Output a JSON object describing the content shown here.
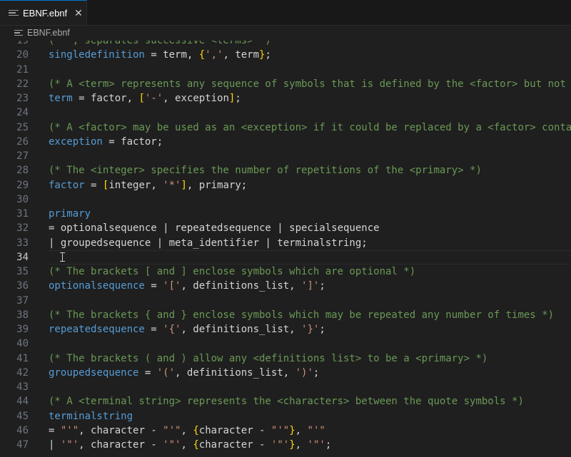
{
  "tab": {
    "label": "EBNF.ebnf",
    "close": "✕"
  },
  "breadcrumb": {
    "file": "EBNF.ebnf"
  },
  "lines": [
    {
      "n": "19",
      "t": [
        [
          "c",
          "(* ', separates successive <terms> *)"
        ]
      ]
    },
    {
      "n": "20",
      "t": [
        [
          "i",
          "singledefinition"
        ],
        [
          "p",
          " = "
        ],
        [
          "p",
          "term, "
        ],
        [
          "b",
          "{"
        ],
        [
          "s",
          "','"
        ],
        [
          "p",
          ", term"
        ],
        [
          "b",
          "}"
        ],
        [
          "p",
          ";"
        ]
      ]
    },
    {
      "n": "21",
      "t": []
    },
    {
      "n": "22",
      "t": [
        [
          "c",
          "(* A <term> represents any sequence of symbols that is defined by the <factor> but not def"
        ]
      ]
    },
    {
      "n": "23",
      "t": [
        [
          "i",
          "term"
        ],
        [
          "p",
          " = factor, "
        ],
        [
          "b",
          "["
        ],
        [
          "s",
          "'-'"
        ],
        [
          "p",
          ", exception"
        ],
        [
          "b",
          "]"
        ],
        [
          "p",
          ";"
        ]
      ]
    },
    {
      "n": "24",
      "t": []
    },
    {
      "n": "25",
      "t": [
        [
          "c",
          "(* A <factor> may be used as an <exception> if it could be replaced by a <factor> contain"
        ]
      ]
    },
    {
      "n": "26",
      "t": [
        [
          "i",
          "exception"
        ],
        [
          "p",
          " = factor;"
        ]
      ]
    },
    {
      "n": "27",
      "t": []
    },
    {
      "n": "28",
      "t": [
        [
          "c",
          "(* The <integer> specifies the number of repetitions of the <primary> *)"
        ]
      ]
    },
    {
      "n": "29",
      "t": [
        [
          "i",
          "factor"
        ],
        [
          "p",
          " = "
        ],
        [
          "b",
          "["
        ],
        [
          "p",
          "integer, "
        ],
        [
          "s",
          "'*'"
        ],
        [
          "b",
          "]"
        ],
        [
          "p",
          ", primary;"
        ]
      ]
    },
    {
      "n": "30",
      "t": []
    },
    {
      "n": "31",
      "t": [
        [
          "i",
          "primary"
        ]
      ]
    },
    {
      "n": "32",
      "t": [
        [
          "p",
          "= optionalsequence | repeatedsequence | specialsequence"
        ]
      ]
    },
    {
      "n": "33",
      "t": [
        [
          "p",
          "| groupedsequence | meta_identifier | terminalstring;"
        ]
      ]
    },
    {
      "n": "34",
      "t": [],
      "current": true
    },
    {
      "n": "35",
      "t": [
        [
          "c",
          "(* The brackets [ and ] enclose symbols which are optional *)"
        ]
      ]
    },
    {
      "n": "36",
      "t": [
        [
          "i",
          "optionalsequence"
        ],
        [
          "p",
          " = "
        ],
        [
          "s",
          "'['"
        ],
        [
          "p",
          ", definitions_list, "
        ],
        [
          "s",
          "']'"
        ],
        [
          "p",
          ";"
        ]
      ]
    },
    {
      "n": "37",
      "t": []
    },
    {
      "n": "38",
      "t": [
        [
          "c",
          "(* The brackets { and } enclose symbols which may be repeated any number of times *)"
        ]
      ]
    },
    {
      "n": "39",
      "t": [
        [
          "i",
          "repeatedsequence"
        ],
        [
          "p",
          " = "
        ],
        [
          "s",
          "'{'"
        ],
        [
          "p",
          ", definitions_list, "
        ],
        [
          "s",
          "'}'"
        ],
        [
          "p",
          ";"
        ]
      ]
    },
    {
      "n": "40",
      "t": []
    },
    {
      "n": "41",
      "t": [
        [
          "c",
          "(* The brackets ( and ) allow any <definitions list> to be a <primary> *)"
        ]
      ]
    },
    {
      "n": "42",
      "t": [
        [
          "i",
          "groupedsequence"
        ],
        [
          "p",
          " = "
        ],
        [
          "s",
          "'('"
        ],
        [
          "p",
          ", definitions_list, "
        ],
        [
          "s",
          "')'"
        ],
        [
          "p",
          ";"
        ]
      ]
    },
    {
      "n": "43",
      "t": []
    },
    {
      "n": "44",
      "t": [
        [
          "c",
          "(* A <terminal string> represents the <characters> between the quote symbols *)"
        ]
      ]
    },
    {
      "n": "45",
      "t": [
        [
          "i",
          "terminalstring"
        ]
      ]
    },
    {
      "n": "46",
      "t": [
        [
          "p",
          "= "
        ],
        [
          "s",
          "\"'\""
        ],
        [
          "p",
          ", character - "
        ],
        [
          "s",
          "\"'\""
        ],
        [
          "p",
          ", "
        ],
        [
          "b",
          "{"
        ],
        [
          "p",
          "character - "
        ],
        [
          "s",
          "\"'\""
        ],
        [
          "b",
          "}"
        ],
        [
          "p",
          ", "
        ],
        [
          "s",
          "\"'\""
        ]
      ]
    },
    {
      "n": "47",
      "t": [
        [
          "p",
          "| "
        ],
        [
          "s",
          "'\"'"
        ],
        [
          "p",
          ", character - "
        ],
        [
          "s",
          "'\"'"
        ],
        [
          "p",
          ", "
        ],
        [
          "b",
          "{"
        ],
        [
          "p",
          "character - "
        ],
        [
          "s",
          "'\"'"
        ],
        [
          "b",
          "}"
        ],
        [
          "p",
          ", "
        ],
        [
          "s",
          "'\"'"
        ],
        [
          "p",
          ";"
        ]
      ]
    }
  ],
  "colors": {
    "comment": "#6a9955",
    "identifier": "#569cd6",
    "string": "#ce9178",
    "bracket": "#ffd700",
    "text": "#d4d4d4",
    "background": "#1f1f1f"
  },
  "icons": {
    "file": "file-lines-icon",
    "close": "close-icon",
    "cursor": "text-cursor-icon"
  }
}
